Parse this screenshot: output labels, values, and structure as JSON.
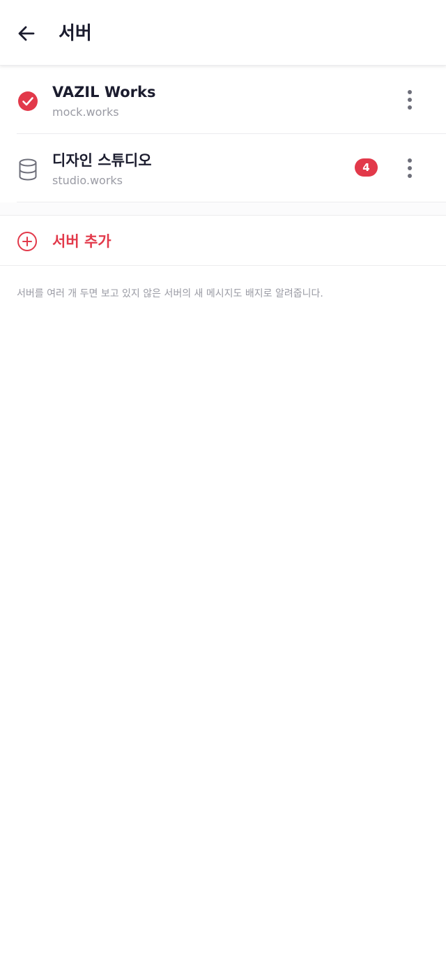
{
  "header": {
    "title": "서버",
    "back_icon": "arrow-left-icon"
  },
  "servers": [
    {
      "name": "VAZIL Works",
      "domain": "mock.works",
      "icon": "check-circle-icon",
      "selected": true,
      "badge": ""
    },
    {
      "name": "디자인 스튜디오",
      "domain": "studio.works",
      "icon": "database-icon",
      "selected": false,
      "badge": "4"
    }
  ],
  "add_server": {
    "label": "서버 추가",
    "icon": "plus-circle-icon"
  },
  "hint": "서버를 여러 개 두면 보고 있지 않은 서버의 새 메시지도 배지로 알려줍니다.",
  "colors": {
    "accent": "#e2394a",
    "text_primary": "#1b1c2e",
    "text_secondary": "#9a9ba4",
    "divider": "#ececee"
  }
}
